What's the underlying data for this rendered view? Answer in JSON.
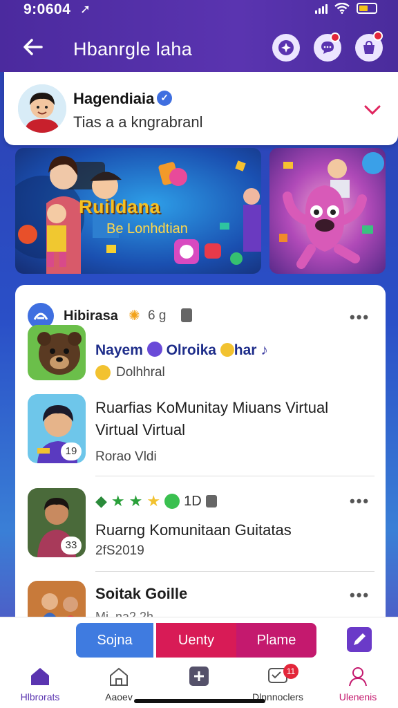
{
  "status": {
    "time": "9:0604",
    "nav_glyph": "➚"
  },
  "header": {
    "title": "Hbanrgle laha"
  },
  "profile": {
    "name": "Hagendiaia",
    "subtitle": "Tias a a kngrabranl"
  },
  "banner": {
    "title": "Ruildana",
    "subtitle": "Be Lonhdtian"
  },
  "feed": {
    "group": {
      "name": "Hibirasa",
      "meta": "6 g"
    },
    "post1": {
      "title": "Nayem",
      "second": "Olroika",
      "tail": "har",
      "sub": "Dolhhral"
    },
    "post2": {
      "text": "Ruarfias KoMunitay Miuans Virtual Virtual Virtual",
      "meta": "Rorao Vldi",
      "badge": "19"
    },
    "post3": {
      "count": "1D",
      "text": "Ruarng Komunitaan Guitatas",
      "meta": "2fS2019",
      "badge": "33"
    },
    "post4": {
      "title": "Soitak Goille",
      "meta": "Mi..na2.2h"
    }
  },
  "actions": {
    "btn1": "Sojna",
    "btn2": "Uenty",
    "btn3": "Plame"
  },
  "nav": {
    "home": "Hlbrorats",
    "explore": "Aaoev",
    "messages": "Dlnnnoclers",
    "messages_badge": "11",
    "profile": "Ulenenis"
  },
  "colors": {
    "primary": "#5a34b0",
    "accent": "#e0245e",
    "blue": "#3f7be0"
  }
}
